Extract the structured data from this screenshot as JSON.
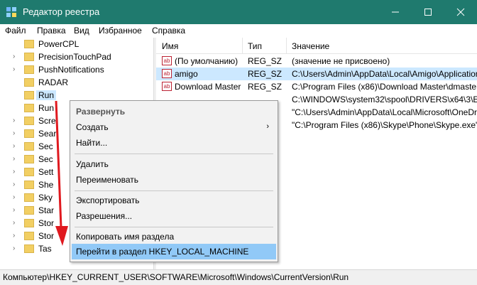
{
  "window": {
    "title": "Редактор реестра"
  },
  "menu": [
    "Файл",
    "Правка",
    "Вид",
    "Избранное",
    "Справка"
  ],
  "tree": [
    {
      "label": "PowerCPL",
      "arrow": false
    },
    {
      "label": "PrecisionTouchPad",
      "arrow": true
    },
    {
      "label": "PushNotifications",
      "arrow": true
    },
    {
      "label": "RADAR",
      "arrow": false
    },
    {
      "label": "Run",
      "arrow": false,
      "selected": true
    },
    {
      "label": "Run",
      "arrow": false
    },
    {
      "label": "Scre",
      "arrow": true
    },
    {
      "label": "Sear",
      "arrow": true
    },
    {
      "label": "Sec",
      "arrow": true
    },
    {
      "label": "Sec",
      "arrow": true
    },
    {
      "label": "Sett",
      "arrow": true
    },
    {
      "label": "She",
      "arrow": true
    },
    {
      "label": "Sky",
      "arrow": true
    },
    {
      "label": "Star",
      "arrow": true
    },
    {
      "label": "Stor",
      "arrow": true
    },
    {
      "label": "Stor",
      "arrow": true
    },
    {
      "label": "Tas",
      "arrow": true
    }
  ],
  "list": {
    "headers": {
      "name": "Имя",
      "type": "Тип",
      "value": "Значение"
    },
    "rows": [
      {
        "name": "(По умолчанию)",
        "type": "REG_SZ",
        "value": "(значение не присвоено)",
        "selected": false
      },
      {
        "name": "amigo",
        "type": "REG_SZ",
        "value": "C:\\Users\\Admin\\AppData\\Local\\Amigo\\Application",
        "selected": true
      },
      {
        "name": "Download Master",
        "type": "REG_SZ",
        "value": "C:\\Program Files (x86)\\Download Master\\dmaster",
        "selected": false
      },
      {
        "name": "",
        "type": "",
        "value": "C:\\WINDOWS\\system32\\spool\\DRIVERS\\x64\\3\\E_",
        "selected": false
      },
      {
        "name": "",
        "type": "",
        "value": "\"C:\\Users\\Admin\\AppData\\Local\\Microsoft\\OneDr",
        "selected": false
      },
      {
        "name": "",
        "type": "",
        "value": "\"C:\\Program Files (x86)\\Skype\\Phone\\Skype.exe\"",
        "selected": false
      }
    ]
  },
  "context_menu": {
    "expand": "Развернуть",
    "create": "Создать",
    "find": "Найти...",
    "delete": "Удалить",
    "rename": "Переименовать",
    "export": "Экспортировать",
    "permissions": "Разрешения...",
    "copy_key": "Копировать имя раздела",
    "goto_hklm": "Перейти в раздел HKEY_LOCAL_MACHINE",
    "submenu_glyph": "›"
  },
  "status": {
    "path": "Компьютер\\HKEY_CURRENT_USER\\SOFTWARE\\Microsoft\\Windows\\CurrentVersion\\Run"
  },
  "colors": {
    "titlebar": "#1f7a6e",
    "selection": "#cce8ff",
    "menu_highlight": "#91c9f7",
    "arrow_annotation": "#e0191f"
  },
  "icons": {
    "app": "registry-icon",
    "value": "string-value-icon",
    "folder": "folder-icon"
  }
}
